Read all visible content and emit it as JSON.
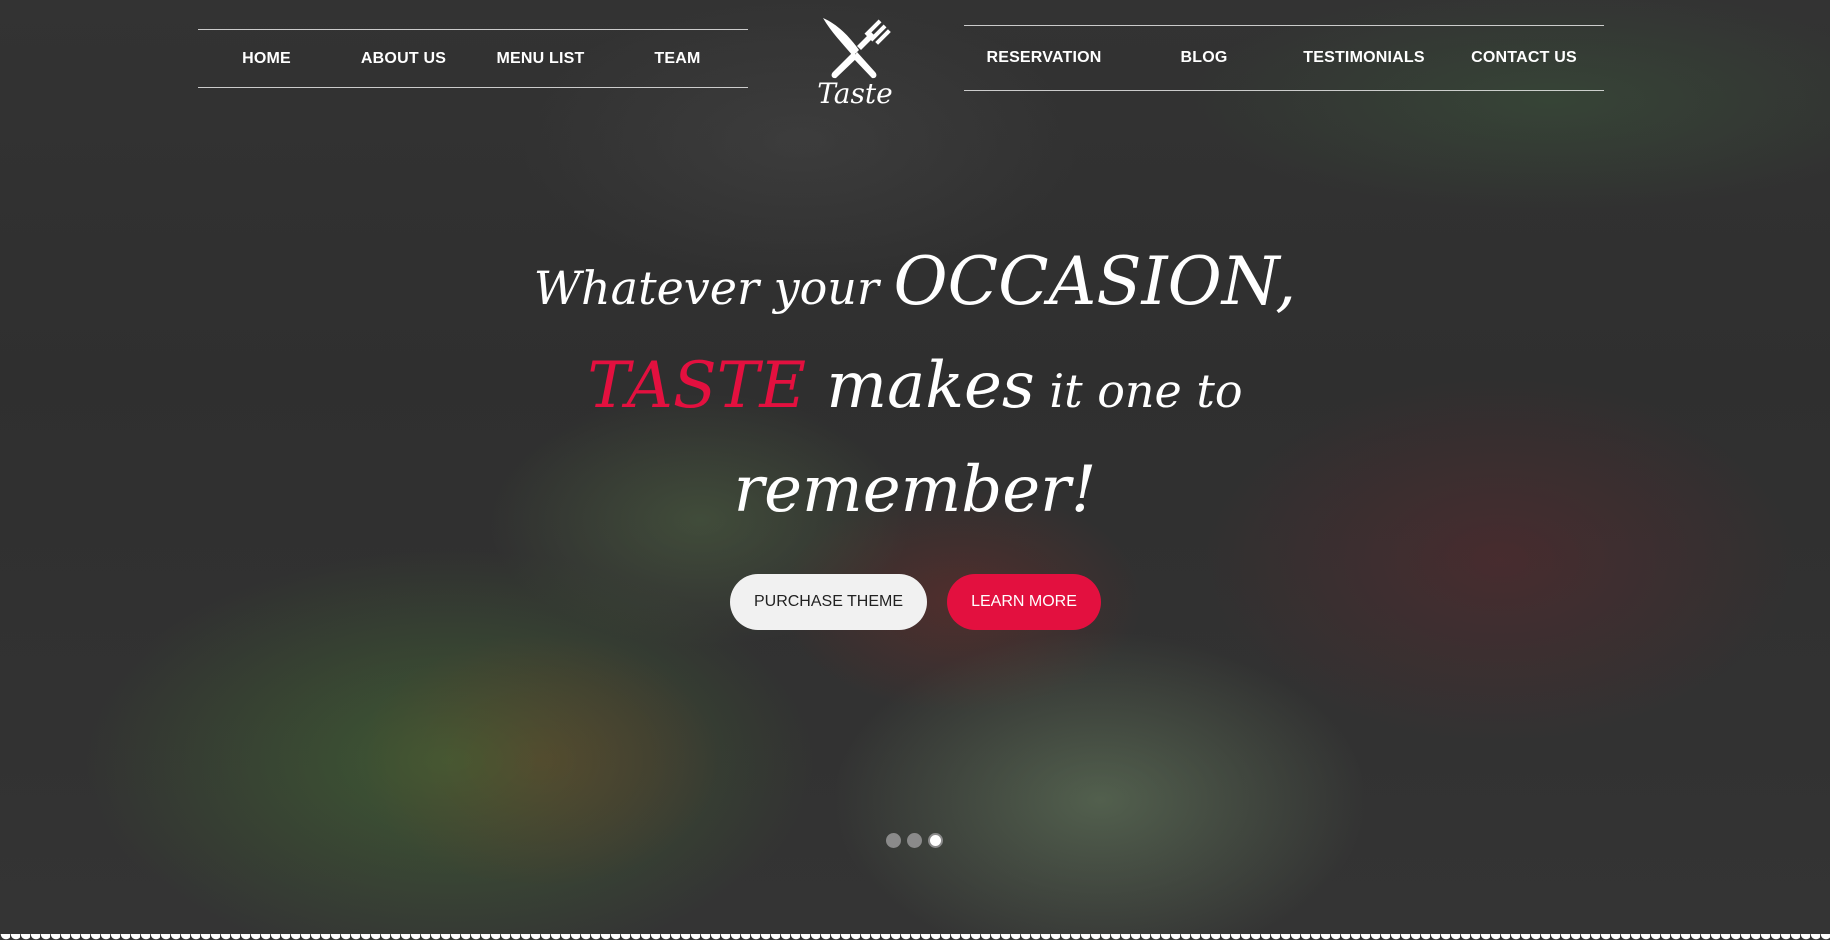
{
  "nav": {
    "left": [
      {
        "label": "HOME"
      },
      {
        "label": "ABOUT US"
      },
      {
        "label": "MENU LIST"
      },
      {
        "label": "TEAM"
      }
    ],
    "right": [
      {
        "label": "RESERVATION"
      },
      {
        "label": "BLOG"
      },
      {
        "label": "TESTIMONIALS"
      },
      {
        "label": "CONTACT US"
      }
    ]
  },
  "logo": {
    "text": "Taste",
    "icon": "fork-knife-icon"
  },
  "hero": {
    "line1_a": "Whatever your ",
    "line1_b": "OCCASION,",
    "line2_a": "TASTE",
    "line2_b": " makes",
    "line2_c": " it one to",
    "line3": "remember!",
    "accent_color": "#e3103f"
  },
  "buttons": {
    "purchase": "PURCHASE THEME",
    "learn": "LEARN MORE"
  },
  "slider": {
    "total": 3,
    "active": 3
  }
}
